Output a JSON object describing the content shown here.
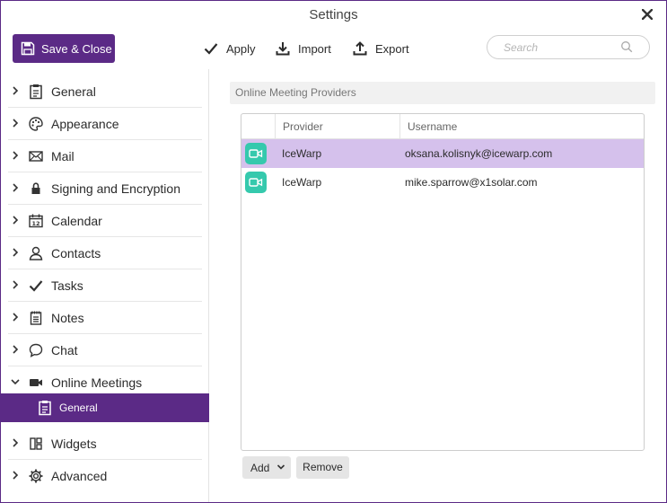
{
  "window": {
    "title": "Settings",
    "accent": "#5b2a86"
  },
  "toolbar": {
    "save_close_label": "Save & Close",
    "apply_label": "Apply",
    "import_label": "Import",
    "export_label": "Export",
    "search_placeholder": "Search"
  },
  "sidebar": {
    "items": [
      {
        "label": "General",
        "icon": "clipboard-icon"
      },
      {
        "label": "Appearance",
        "icon": "palette-icon"
      },
      {
        "label": "Mail",
        "icon": "envelope-icon"
      },
      {
        "label": "Signing and Encryption",
        "icon": "lock-icon"
      },
      {
        "label": "Calendar",
        "icon": "calendar-icon"
      },
      {
        "label": "Contacts",
        "icon": "person-icon"
      },
      {
        "label": "Tasks",
        "icon": "checkmark-icon"
      },
      {
        "label": "Notes",
        "icon": "notepad-icon"
      },
      {
        "label": "Chat",
        "icon": "speech-bubble-icon"
      },
      {
        "label": "Online Meetings",
        "icon": "video-camera-icon",
        "expanded": true
      },
      {
        "label": "General",
        "icon": "clipboard-icon",
        "child": true,
        "active": true
      },
      {
        "label": "Widgets",
        "icon": "widgets-icon"
      },
      {
        "label": "Advanced",
        "icon": "gear-icon"
      }
    ]
  },
  "content": {
    "section_title": "Online Meeting Providers",
    "columns": [
      "Provider",
      "Username"
    ],
    "rows": [
      {
        "provider": "IceWarp",
        "username": "oksana.kolisnyk@icewarp.com",
        "selected": true
      },
      {
        "provider": "IceWarp",
        "username": "mike.sparrow@x1solar.com",
        "selected": false
      }
    ],
    "add_label": "Add",
    "remove_label": "Remove",
    "selected_row_color": "#d5c1ec",
    "provider_icon_color": "#35c9ad"
  }
}
